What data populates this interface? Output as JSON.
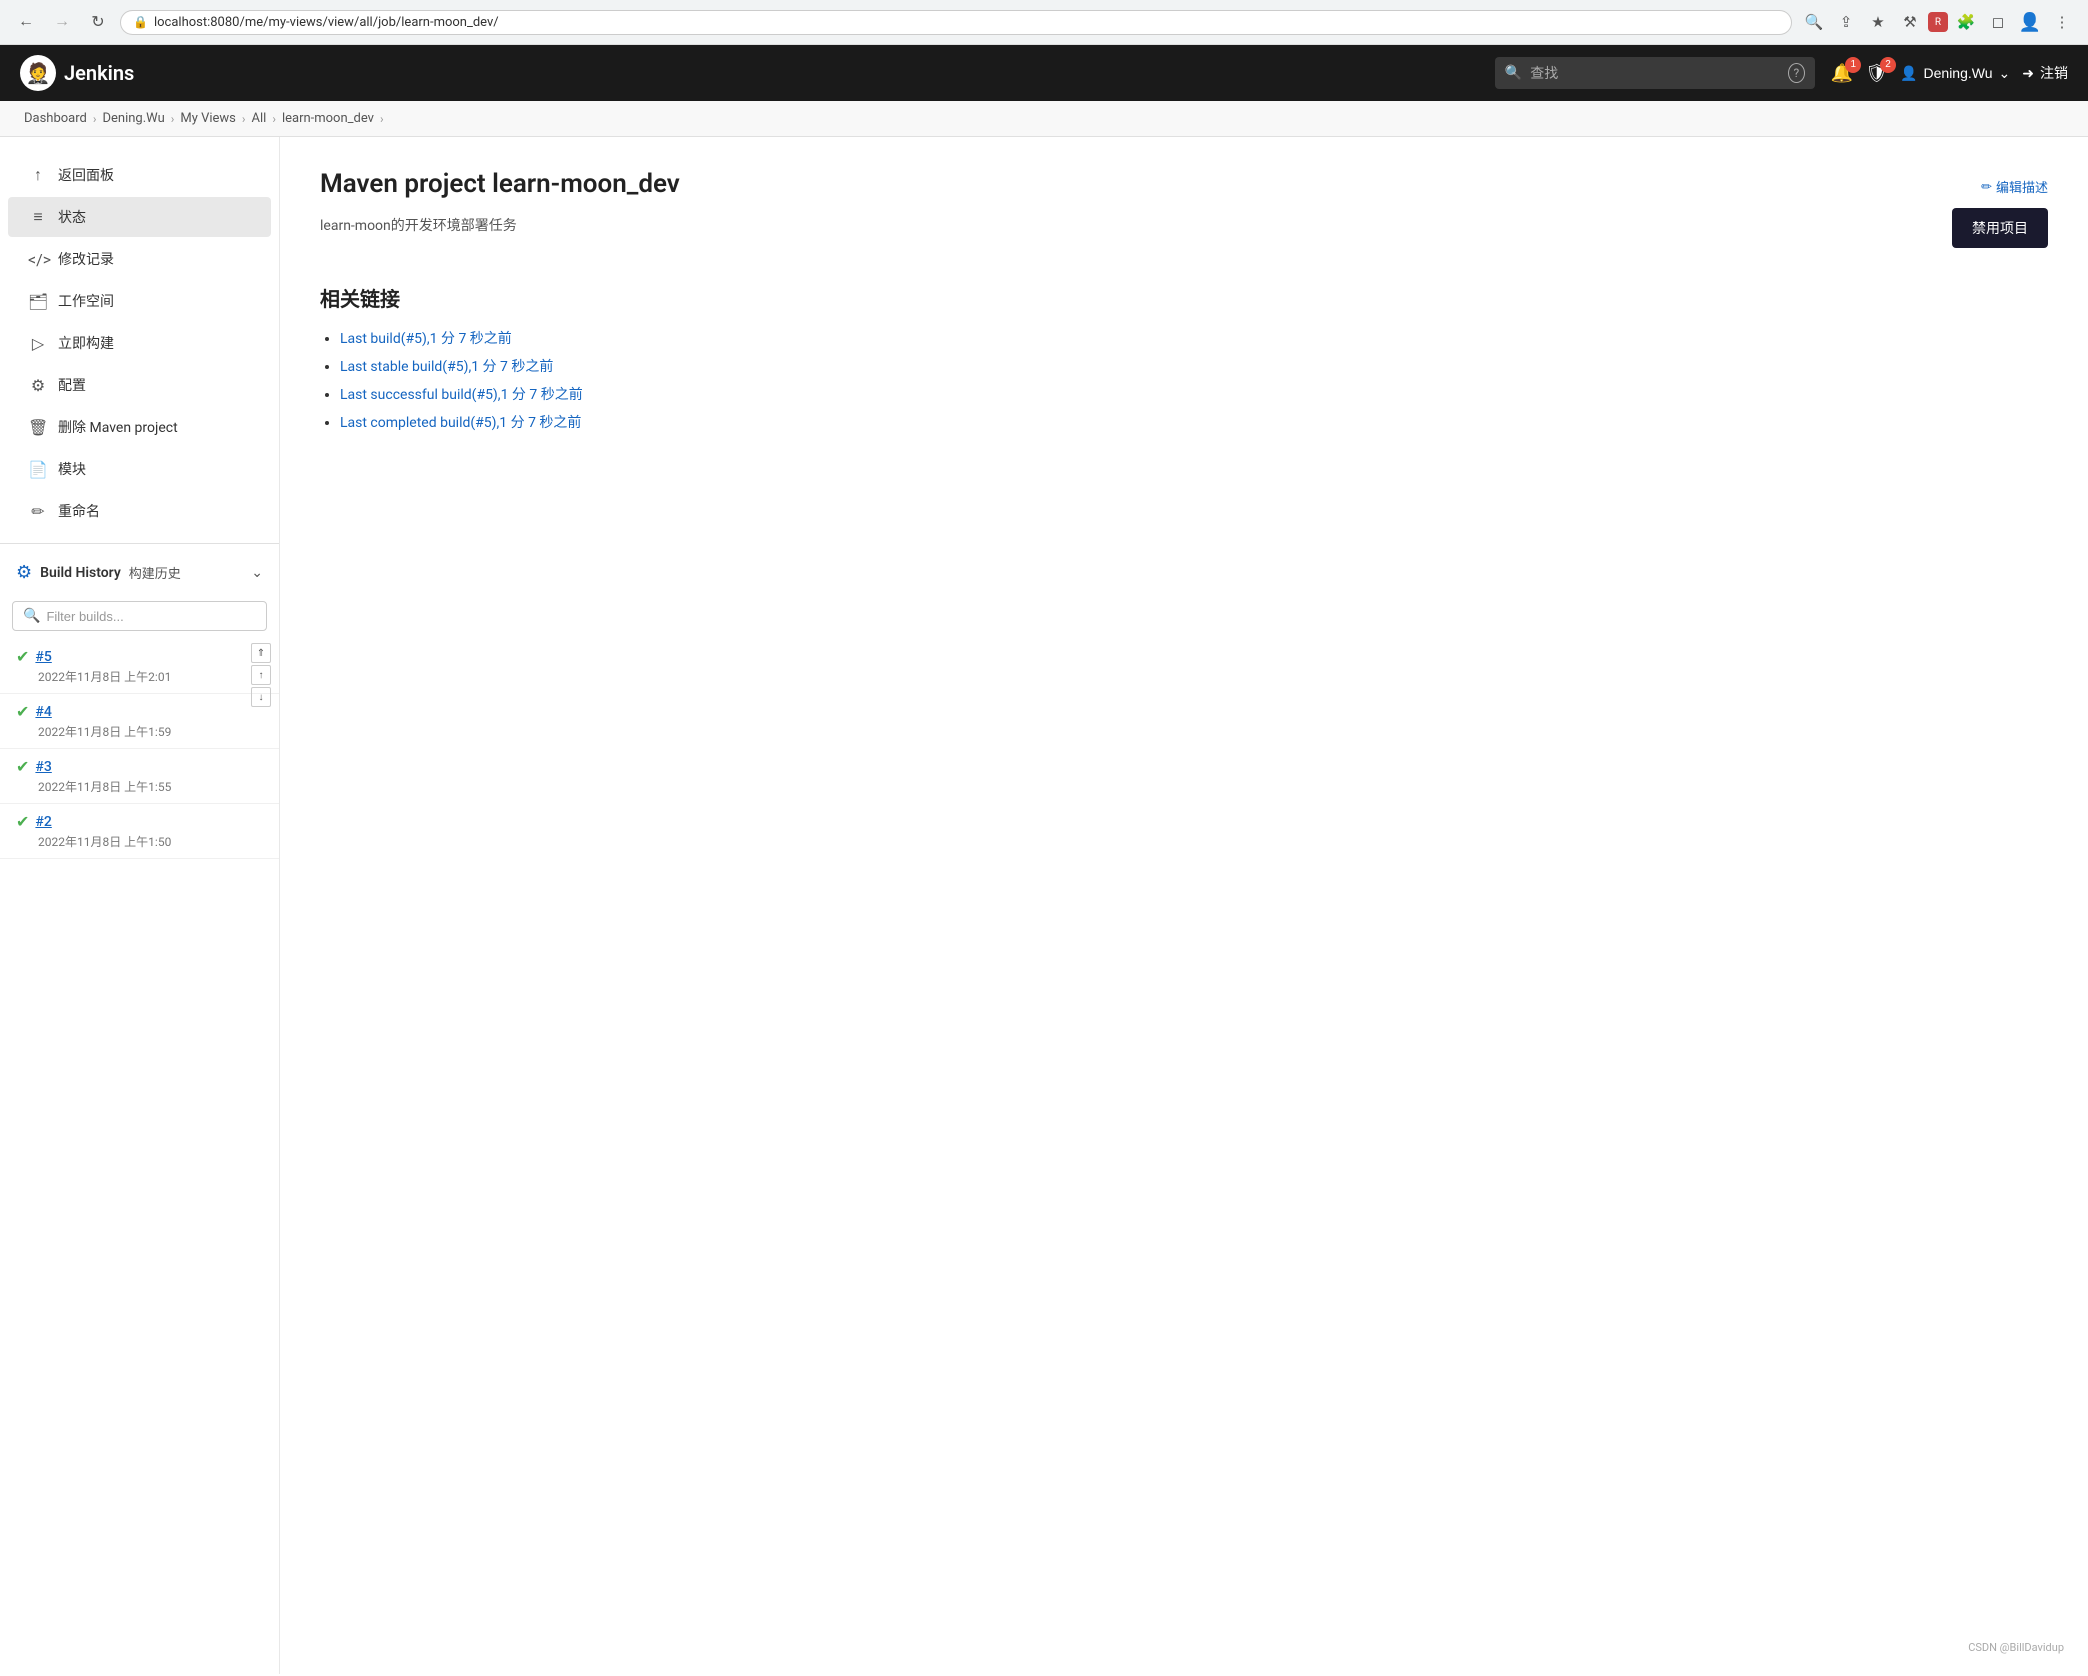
{
  "browser": {
    "url": "localhost:8080/me/my-views/view/all/job/learn-moon_dev/",
    "back_disabled": false,
    "forward_disabled": false
  },
  "header": {
    "logo_text": "Jenkins",
    "logo_emoji": "🤵",
    "search_placeholder": "查找",
    "notification_count": "1",
    "shield_count": "2",
    "user_name": "Dening.Wu",
    "logout_label": "注销"
  },
  "breadcrumb": {
    "items": [
      {
        "label": "Dashboard",
        "href": "#"
      },
      {
        "label": "Dening.Wu",
        "href": "#"
      },
      {
        "label": "My Views",
        "href": "#"
      },
      {
        "label": "All",
        "href": "#"
      },
      {
        "label": "learn-moon_dev",
        "href": "#"
      }
    ]
  },
  "sidebar": {
    "items": [
      {
        "id": "back",
        "label": "返回面板",
        "icon": "↑"
      },
      {
        "id": "status",
        "label": "状态",
        "icon": "≡",
        "active": true
      },
      {
        "id": "changes",
        "label": "修改记录",
        "icon": "</>"
      },
      {
        "id": "workspace",
        "label": "工作空间",
        "icon": "🗂"
      },
      {
        "id": "build-now",
        "label": "立即构建",
        "icon": "▷"
      },
      {
        "id": "configure",
        "label": "配置",
        "icon": "⚙"
      },
      {
        "id": "delete",
        "label": "删除 Maven project",
        "icon": "🗑"
      },
      {
        "id": "modules",
        "label": "模块",
        "icon": "📄"
      },
      {
        "id": "rename",
        "label": "重命名",
        "icon": "✏"
      }
    ]
  },
  "build_history": {
    "title": "Build History",
    "subtitle": "构建历史",
    "filter_placeholder": "Filter builds...",
    "builds": [
      {
        "num": "#5",
        "date": "2022年11月8日 上午2:01",
        "status": "success"
      },
      {
        "num": "#4",
        "date": "2022年11月8日 上午1:59",
        "status": "success"
      },
      {
        "num": "#3",
        "date": "2022年11月8日 上午1:55",
        "status": "success"
      },
      {
        "num": "#2",
        "date": "2022年11月8日 上午1:50",
        "status": "success"
      }
    ]
  },
  "content": {
    "title": "Maven project learn-moon_dev",
    "description": "learn-moon的开发环境部署任务",
    "edit_desc_label": "编辑描述",
    "disable_label": "禁用项目",
    "related_links_title": "相关链接",
    "links": [
      {
        "label": "Last build(#5),1 分 7 秒之前",
        "href": "#"
      },
      {
        "label": "Last stable build(#5),1 分 7 秒之前",
        "href": "#"
      },
      {
        "label": "Last successful build(#5),1 分 7 秒之前",
        "href": "#"
      },
      {
        "label": "Last completed build(#5),1 分 7 秒之前",
        "href": "#"
      }
    ]
  },
  "watermark": "CSDN @BillDavidup"
}
